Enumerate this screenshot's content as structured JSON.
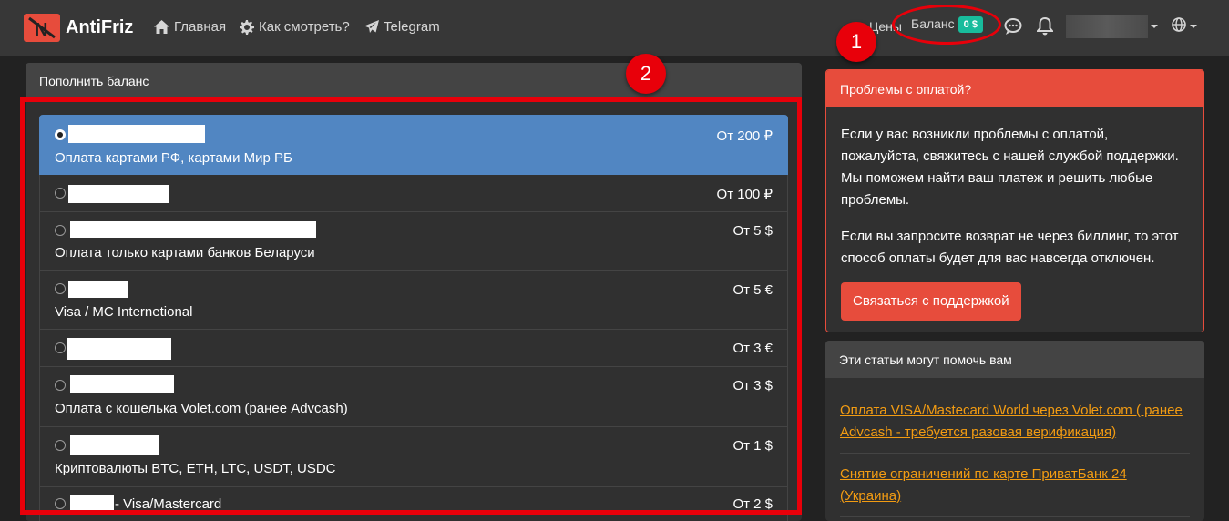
{
  "brand": {
    "name": "AntiFriz"
  },
  "nav": {
    "home": "Главная",
    "howto": "Как смотреть?",
    "telegram": "Telegram",
    "prices": "Цены",
    "balance_label": "Баланс",
    "balance_value": "0 $"
  },
  "annotations": {
    "one": "1",
    "two": "2"
  },
  "topup": {
    "title": "Пополнить баланс",
    "methods": [
      {
        "desc": "Оплата картами РФ, картами Мир РБ",
        "price": "От 200 ₽",
        "selected": true
      },
      {
        "desc": "",
        "price": "От 100 ₽",
        "selected": false
      },
      {
        "desc": "Оплата только картами банков Беларуси",
        "price": "От 5 $",
        "selected": false
      },
      {
        "desc": "Visa / MC Internetional",
        "price": "От 5 €",
        "selected": false
      },
      {
        "desc": "",
        "price": "От 3 €",
        "selected": false
      },
      {
        "desc": "Оплата с кошелька Volet.com (ранее Advcash)",
        "price": "От 3 $",
        "selected": false
      },
      {
        "desc": "Криптовалюты BTC, ETH, LTC, USDT, USDC",
        "price": "От 1 $",
        "selected": false
      },
      {
        "title_suffix": "- Visa/Mastercard",
        "price": "От 2 $",
        "selected": false
      }
    ]
  },
  "problems": {
    "title": "Проблемы с оплатой?",
    "p1": "Если у вас возникли проблемы с оплатой, пожалуйста, свяжитесь с нашей службой поддержки. Мы поможем найти ваш платеж и решить любые проблемы.",
    "p2": "Если вы запросите возврат не через биллинг, то этот способ оплаты будет для вас навсегда отключен.",
    "button": "Связаться с поддержкой"
  },
  "articles": {
    "title": "Эти статьи могут помочь вам",
    "items": [
      "Оплата VISA/Mastecard World через Volet.com ( ранее Advcash - требуется разовая верификация)",
      "Снятие ограничений по карте ПриватБанк 24 (Украина)"
    ]
  },
  "colors": {
    "accent": "#5186c2",
    "danger": "#e74c3c",
    "success": "#18bc9c",
    "link": "#f39c12",
    "annotation": "#e8000a"
  }
}
